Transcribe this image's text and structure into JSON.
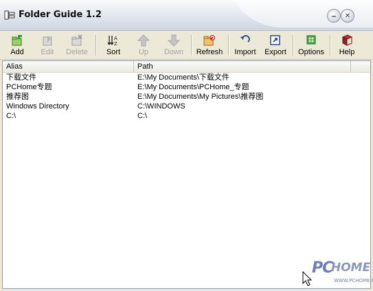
{
  "window": {
    "title": "Folder Guide 1.2",
    "minimize_symbol": "–",
    "close_symbol": "✕"
  },
  "toolbar": {
    "buttons": [
      {
        "label": "Add",
        "icon": "add-folder-icon",
        "enabled": true
      },
      {
        "label": "Edit",
        "icon": "edit-folder-icon",
        "enabled": false
      },
      {
        "label": "Delete",
        "icon": "delete-folder-icon",
        "enabled": false
      },
      {
        "label": "Sort",
        "icon": "sort-icon",
        "enabled": true
      },
      {
        "label": "Up",
        "icon": "arrow-up-icon",
        "enabled": false
      },
      {
        "label": "Down",
        "icon": "arrow-down-icon",
        "enabled": false
      },
      {
        "label": "Refresh",
        "icon": "refresh-icon",
        "enabled": true
      },
      {
        "label": "Import",
        "icon": "import-icon",
        "enabled": true
      },
      {
        "label": "Export",
        "icon": "export-icon",
        "enabled": true
      },
      {
        "label": "Options",
        "icon": "options-icon",
        "enabled": true
      },
      {
        "label": "Help",
        "icon": "help-book-icon",
        "enabled": true
      }
    ]
  },
  "list": {
    "columns": [
      "Alias",
      "Path"
    ],
    "rows": [
      {
        "alias": "下载文件",
        "path": "E:\\My Documents\\下载文件"
      },
      {
        "alias": "PCHome专题",
        "path": "E:\\My Documents\\PCHome_专题"
      },
      {
        "alias": "推荐图",
        "path": "E:\\My Documents\\My Pictures\\推荐图"
      },
      {
        "alias": "Windows Directory",
        "path": "C:\\WINDOWS"
      },
      {
        "alias": "C:\\",
        "path": "C:\\"
      }
    ]
  },
  "watermark": {
    "pc": "PC",
    "home": "HOME",
    "url": "WWW.PCHOME.NET"
  },
  "colors": {
    "window_bg": "#ece9d8",
    "list_border": "#7f9db9",
    "disabled_text": "#a3a3a3",
    "watermark": "#6e7fb0"
  }
}
